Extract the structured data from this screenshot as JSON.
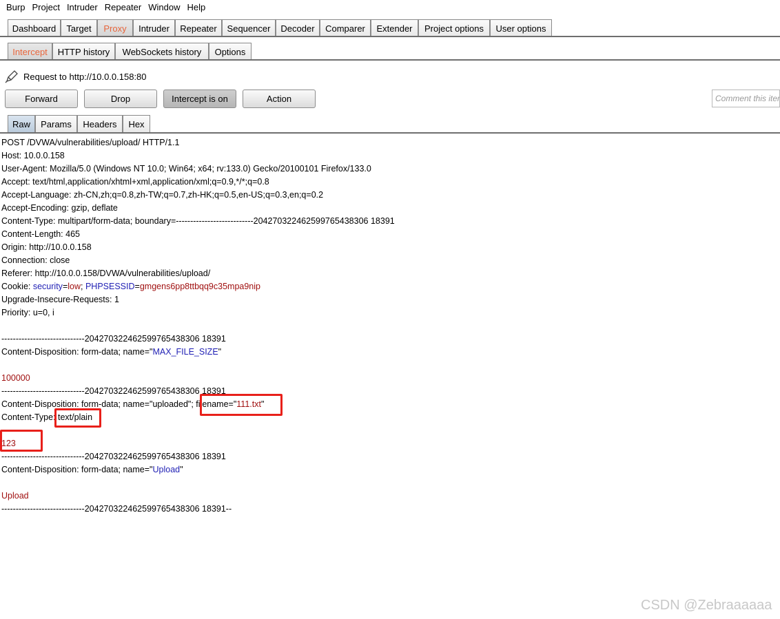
{
  "menu": [
    "Burp",
    "Project",
    "Intruder",
    "Repeater",
    "Window",
    "Help"
  ],
  "main_tabs": [
    "Dashboard",
    "Target",
    "Proxy",
    "Intruder",
    "Repeater",
    "Sequencer",
    "Decoder",
    "Comparer",
    "Extender",
    "Project options",
    "User options"
  ],
  "proxy_tabs": [
    "Intercept",
    "HTTP history",
    "WebSockets history",
    "Options"
  ],
  "request_label": "Request to http://10.0.0.158:80",
  "buttons": {
    "forward": "Forward",
    "drop": "Drop",
    "intercept": "Intercept is on",
    "action": "Action"
  },
  "comment_placeholder": "Comment this item",
  "view_tabs": [
    "Raw",
    "Params",
    "Headers",
    "Hex"
  ],
  "request_lines": {
    "l0": "POST /DVWA/vulnerabilities/upload/ HTTP/1.1",
    "l1": "Host: 10.0.0.158",
    "l2": "User-Agent: Mozilla/5.0 (Windows NT 10.0; Win64; x64; rv:133.0) Gecko/20100101 Firefox/133.0",
    "l3": "Accept: text/html,application/xhtml+xml,application/xml;q=0.9,*/*;q=0.8",
    "l4": "Accept-Language: zh-CN,zh;q=0.8,zh-TW;q=0.7,zh-HK;q=0.5,en-US;q=0.3,en;q=0.2",
    "l5": "Accept-Encoding: gzip, deflate",
    "l6": "Content-Type: multipart/form-data; boundary=---------------------------204270322462599765438306 18391",
    "l7": "Content-Length: 465",
    "l8": "Origin: http://10.0.0.158",
    "l9": "Connection: close",
    "l10": "Referer: http://10.0.0.158/DVWA/vulnerabilities/upload/",
    "cookie_prefix": "Cookie: ",
    "cookie_k1": "security",
    "cookie_eq1": "=",
    "cookie_v1": "low",
    "cookie_sep": "; ",
    "cookie_k2": "PHPSESSID",
    "cookie_eq2": "=",
    "cookie_v2": "gmgens6pp8ttbqq9c35mpa9nip",
    "l12": "Upgrade-Insecure-Requests: 1",
    "l13": "Priority: u=0, i",
    "l14": "",
    "boundary": "-----------------------------204270322462599765438306 18391",
    "cd_prefix": "Content-Disposition: form-data; name=\"",
    "cd1_name": "MAX_FILE_SIZE",
    "quote": "\"",
    "val1": "100000",
    "cd2_text": "Content-Disposition: form-data; name=\"uploaded\"; ",
    "cd2_filename_key": "filename=\"",
    "cd2_filename": "111.txt",
    "ct_text": "Content-Type: ",
    "ct_value": "text/plain",
    "val2": "123",
    "cd3_name": "Upload",
    "val3": "Upload",
    "boundary_end": "-----------------------------204270322462599765438306 18391--"
  },
  "watermark": "CSDN @Zebraaaaaa",
  "colors": {
    "active_tab_text": "#e8653b",
    "param_name": "#1f1fb4",
    "param_value": "#a01010",
    "highlight_box": "#e8201a"
  }
}
